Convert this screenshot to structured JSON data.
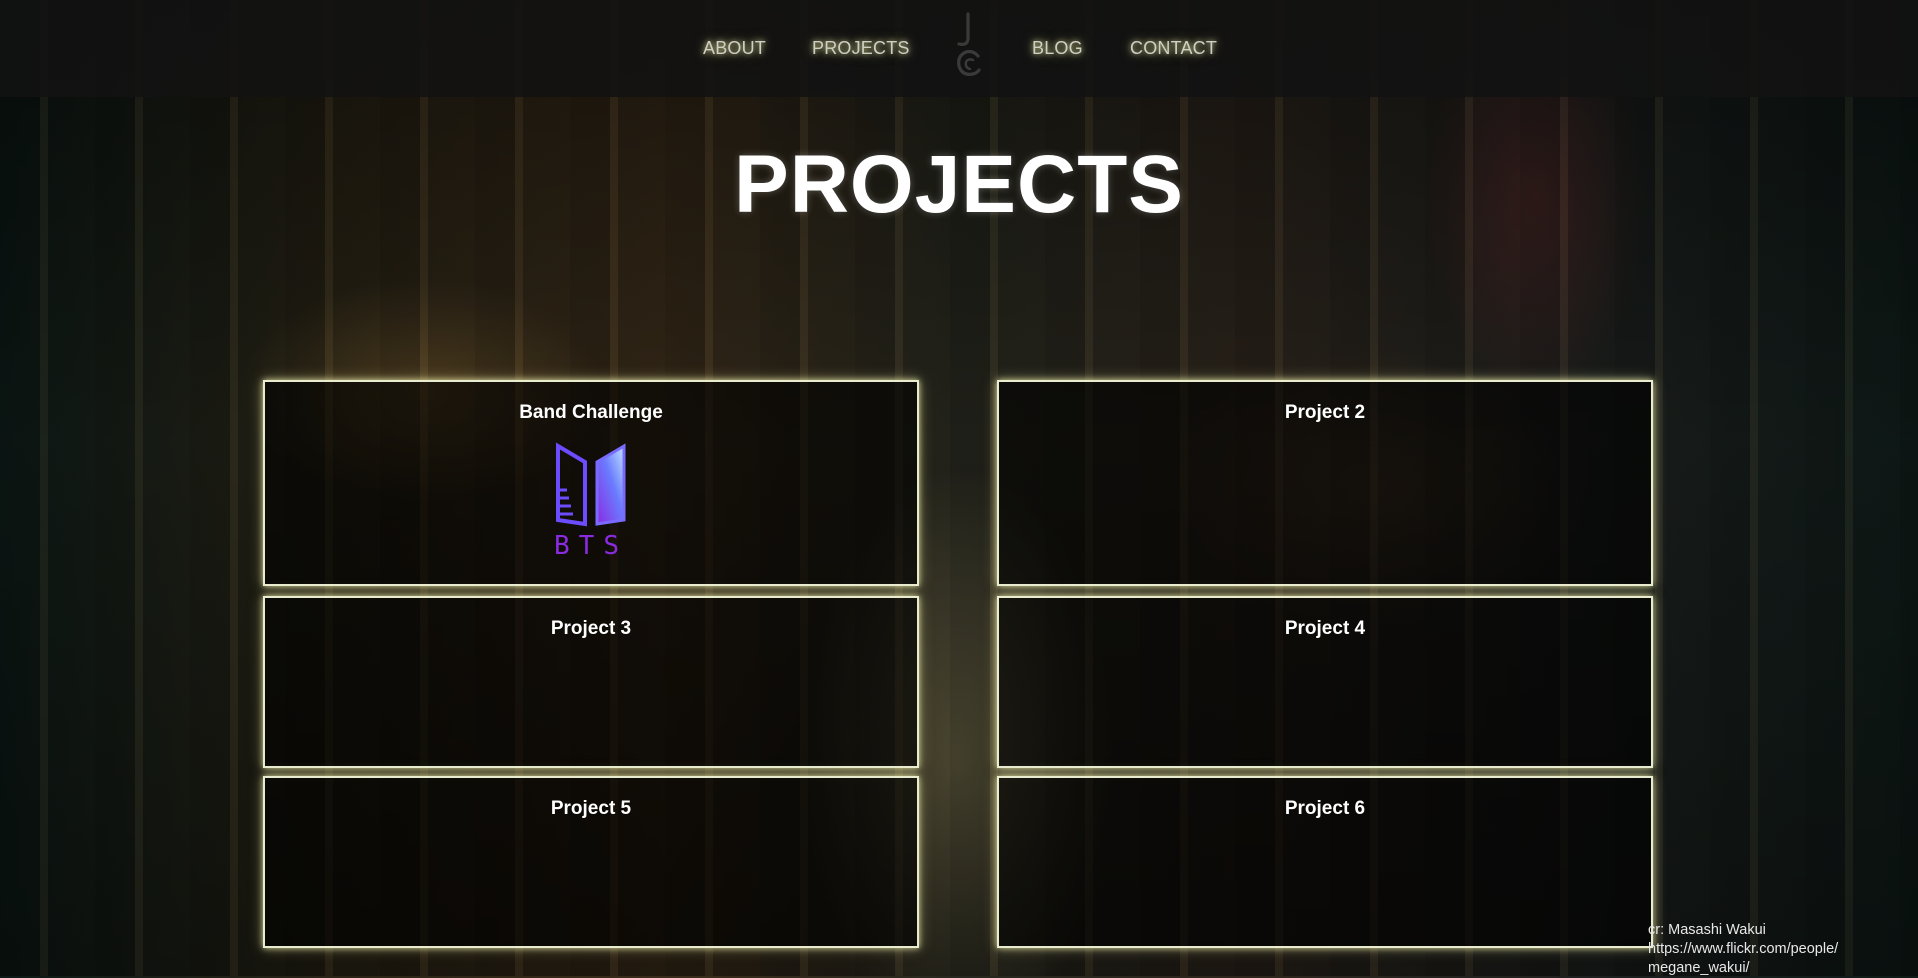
{
  "nav": {
    "items": [
      {
        "label": "ABOUT"
      },
      {
        "label": "PROJECTS"
      },
      {
        "label": "BLOG"
      },
      {
        "label": "CONTACT"
      }
    ],
    "logo_icon": "jc-monogram-icon"
  },
  "page_title": "PROJECTS",
  "projects": [
    {
      "title": "Band Challenge",
      "logo_text": "BTS",
      "logo_icon": "bts-logo-icon"
    },
    {
      "title": "Project 2"
    },
    {
      "title": "Project 3"
    },
    {
      "title": "Project 4"
    },
    {
      "title": "Project 5"
    },
    {
      "title": "Project 6"
    }
  ],
  "credit": {
    "line1": "cr: Masashi Wakui",
    "line2": "https://www.flickr.com/people/",
    "line3": "megane_wakui/"
  },
  "colors": {
    "card_border": "#e9eccf",
    "nav_text": "#cfd0c4",
    "bts_gradient_start": "#8a2be2",
    "bts_gradient_end": "#9fd3ff"
  }
}
